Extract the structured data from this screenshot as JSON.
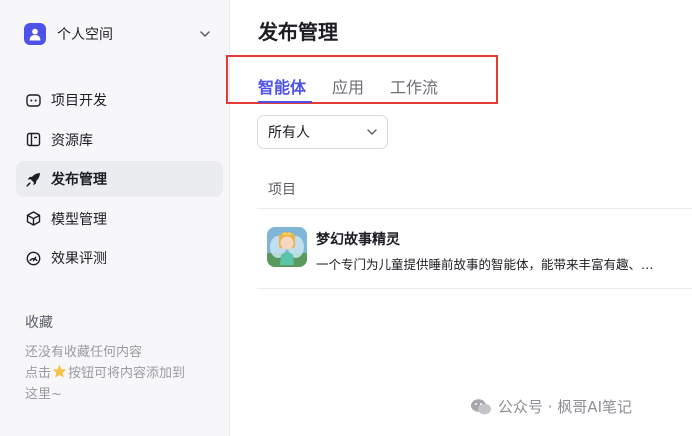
{
  "sidebar": {
    "space_label": "个人空间",
    "items": [
      {
        "label": "项目开发",
        "icon": "project-icon"
      },
      {
        "label": "资源库",
        "icon": "library-icon"
      },
      {
        "label": "发布管理",
        "icon": "rocket-icon"
      },
      {
        "label": "模型管理",
        "icon": "model-icon"
      },
      {
        "label": "效果评测",
        "icon": "gauge-icon"
      }
    ],
    "active_index": 2,
    "favorites": {
      "title": "收藏",
      "empty_line1": "还没有收藏任何内容",
      "empty_line2_prefix": "点击",
      "empty_line2_suffix": "按钮可将内容添加到",
      "empty_line3": "这里~"
    }
  },
  "main": {
    "title": "发布管理",
    "tabs": [
      {
        "label": "智能体",
        "active": true
      },
      {
        "label": "应用",
        "active": false
      },
      {
        "label": "工作流",
        "active": false
      }
    ],
    "filter": {
      "value": "所有人"
    },
    "table": {
      "column_header": "项目",
      "rows": [
        {
          "name": "梦幻故事精灵",
          "description": "一个专门为儿童提供睡前故事的智能体，能带来丰富有趣、…"
        }
      ]
    }
  },
  "watermark": {
    "text": "公众号 · 枫哥AI笔记"
  },
  "colors": {
    "accent": "#4d53e8",
    "highlight_box": "#e53935",
    "sidebar_bg": "#f7f7f9"
  }
}
